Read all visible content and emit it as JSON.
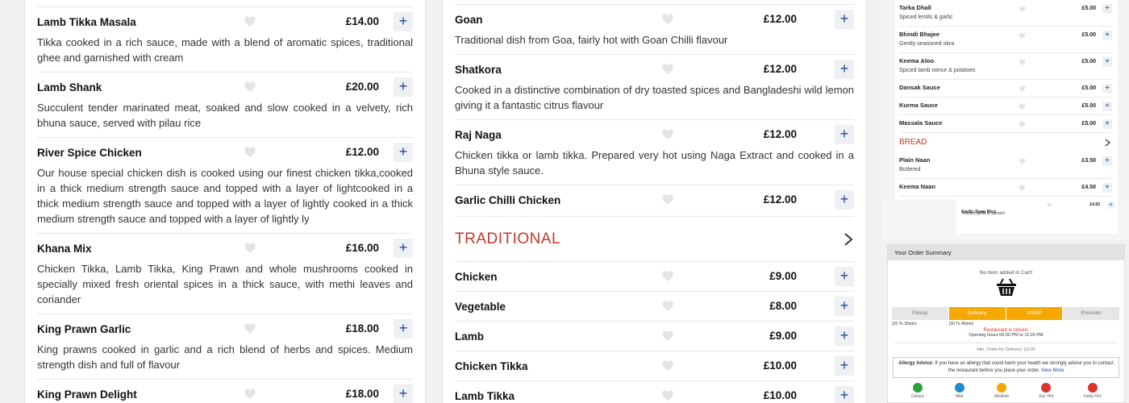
{
  "col1": {
    "items": [
      {
        "name": "Lamb Tikka Masala",
        "price": "£14.00",
        "desc": "Tikka cooked in a rich sauce, made with a blend of aromatic spices, traditional ghee and garnished with cream"
      },
      {
        "name": "Lamb Shank",
        "price": "£20.00",
        "desc": "Succulent tender marinated meat, soaked and slow cooked in a velvety, rich bhuna sauce, served with pilau rice"
      },
      {
        "name": "River Spice Chicken",
        "price": "£12.00",
        "desc": "Our house special chicken dish is cooked using our finest chicken tikka,cooked in a thick medium strength sauce and topped with a layer of lightcooked in a thick medium strength sauce and topped with a layer of lightly cooked in a thick medium strength sauce and topped with a layer of lightly ly"
      },
      {
        "name": "Khana Mix",
        "price": "£16.00",
        "desc": "Chicken Tikka, Lamb Tikka, King Prawn and whole mushrooms cooked in specially mixed fresh oriental spices in a thick sauce, with methi leaves and coriander"
      },
      {
        "name": "King Prawn Garlic",
        "price": "£18.00",
        "desc": "King prawns cooked in garlic and a rich blend of herbs and spices. Medium strength dish and full of flavour"
      },
      {
        "name": "King Prawn Delight",
        "price": "£18.00",
        "desc": ""
      }
    ]
  },
  "col2": {
    "items": [
      {
        "name": "Goan",
        "price": "£12.00",
        "desc": "Traditional dish from Goa, fairly hot with Goan Chilli flavour"
      },
      {
        "name": "Shatkora",
        "price": "£12.00",
        "desc": "Cooked in a distinctive combination of dry toasted spices and Bangladeshi wild lemon giving it a fantastic citrus flavour"
      },
      {
        "name": "Raj Naga",
        "price": "£12.00",
        "desc": "Chicken tikka or lamb tikka. Prepared very hot using Naga Extract and cooked in a Bhuna style sauce."
      },
      {
        "name": "Garlic Chilli Chicken",
        "price": "£12.00",
        "desc": ""
      }
    ],
    "category": "TRADITIONAL",
    "trad_items": [
      {
        "name": "Chicken",
        "price": "£9.00"
      },
      {
        "name": "Vegetable",
        "price": "£8.00"
      },
      {
        "name": "Lamb",
        "price": "£9.00"
      },
      {
        "name": "Chicken Tikka",
        "price": "£10.00"
      },
      {
        "name": "Lamb Tikka",
        "price": "£10.00"
      }
    ]
  },
  "mini1": {
    "items": [
      {
        "name": "Tarka Dhall",
        "desc": "Spiced lentils & garlic",
        "price": "£5.00"
      },
      {
        "name": "Bhindi Bhajee",
        "desc": "Gently seasoned okra",
        "price": "£5.00"
      },
      {
        "name": "Keema Aloo",
        "desc": "Spiced lamb mince & potatoes",
        "price": "£5.00"
      },
      {
        "name": "Dansak Sauce",
        "desc": "",
        "price": "£5.00"
      },
      {
        "name": "Kurma Sauce",
        "desc": "",
        "price": "£5.00"
      },
      {
        "name": "Massala Sauce",
        "desc": "",
        "price": "£5.00"
      }
    ],
    "category": "BREAD",
    "bread_items": [
      {
        "name": "Plain Naan",
        "desc": "Buttered",
        "price": "£3.50"
      },
      {
        "name": "Keema Naan",
        "desc": "",
        "price": "£4.50"
      }
    ]
  },
  "mini2": {
    "name": "Garlic Saag Rice",
    "desc": "Toasted garlic & spinach",
    "price": "£4.50"
  },
  "summary": {
    "title": "Your Order Summary",
    "empty": "No Item added in Cart!",
    "tabs": [
      "Pickup",
      "Delivery",
      "ASAP",
      "Preorder"
    ],
    "pickup_time": "(20 To 30min)",
    "delivery_time": "(30 To 45min)",
    "closed": "Restaurant is closed.",
    "hours": "Opening hours 05:30 PM to 11:00 PM",
    "min_order": "Min. Order for Delivery: £0.00",
    "allergy_label": "Allergy Advice:",
    "allergy_text": "If you have an allergy that could harm your health we strongly advise you to contact the restaurant before you place your order.",
    "view_more": "View More",
    "legend": [
      {
        "label": "Celiacy",
        "color": "#2e9e3f"
      },
      {
        "label": "Mild",
        "color": "#1d8fd1"
      },
      {
        "label": "Medium",
        "color": "#f5a800"
      },
      {
        "label": "Ext. Hot",
        "color": "#d9342b"
      },
      {
        "label": "Fairly Hot",
        "color": "#d9342b"
      }
    ]
  }
}
